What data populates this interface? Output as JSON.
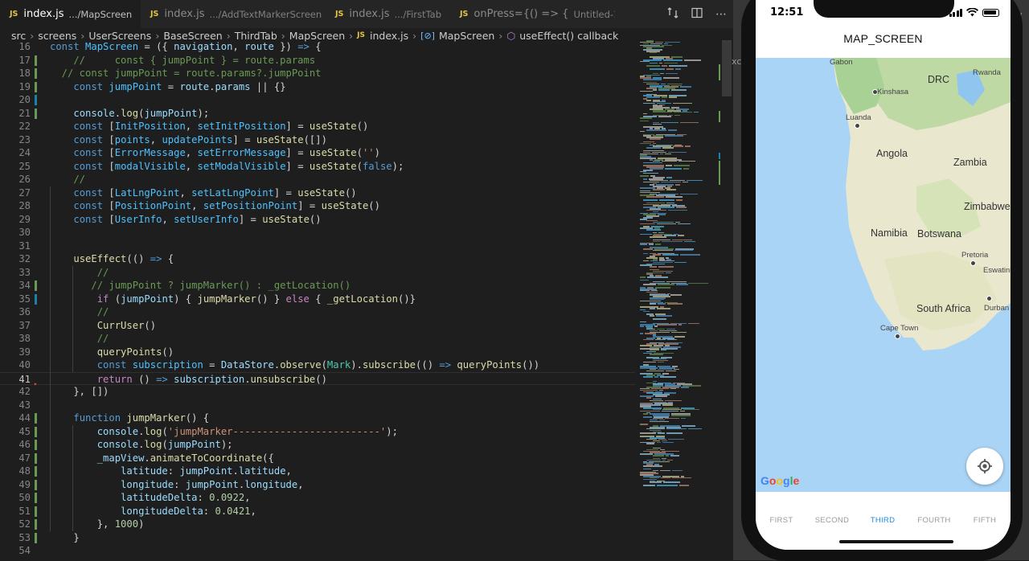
{
  "editor": {
    "tabs": [
      {
        "name": "index.js",
        "desc": ".../MapScreen",
        "active": true
      },
      {
        "name": "index.js",
        "desc": ".../AddTextMarkerScreen",
        "active": false
      },
      {
        "name": "index.js",
        "desc": ".../FirstTab",
        "active": false
      },
      {
        "name": "onPress={() => {",
        "desc": "Untitled-1",
        "active": false
      }
    ],
    "breadcrumb": [
      "src",
      "screens",
      "UserScreens",
      "BaseScreen",
      "ThirdTab",
      "MapScreen",
      "index.js",
      "MapScreen",
      "useEffect() callback"
    ],
    "lines": [
      {
        "n": "16",
        "t": [
          [
            "const ",
            "#569cd6"
          ],
          [
            "MapScreen",
            "#4fc1ff"
          ],
          [
            " = ({ ",
            "#d4d4d4"
          ],
          [
            "navigation",
            "#9cdcfe"
          ],
          [
            ", ",
            "#d4d4d4"
          ],
          [
            "route",
            "#9cdcfe"
          ],
          [
            " }) ",
            "#d4d4d4"
          ],
          [
            "=>",
            "#569cd6"
          ],
          [
            " {",
            "#d4d4d4"
          ]
        ]
      },
      {
        "n": "17",
        "t": [
          [
            "    //     const { jumpPoint } = route.params",
            "#6a9955"
          ]
        ]
      },
      {
        "n": "18",
        "t": [
          [
            "  // const jumpPoint = route.params?.jumpPoint",
            "#6a9955"
          ]
        ]
      },
      {
        "n": "19",
        "t": [
          [
            "    ",
            "#d4d4d4"
          ],
          [
            "const ",
            "#569cd6"
          ],
          [
            "jumpPoint",
            "#4fc1ff"
          ],
          [
            " = ",
            "#d4d4d4"
          ],
          [
            "route",
            "#9cdcfe"
          ],
          [
            ".",
            "#d4d4d4"
          ],
          [
            "params",
            "#9cdcfe"
          ],
          [
            " || {}",
            "#d4d4d4"
          ]
        ]
      },
      {
        "n": "20",
        "t": [
          [
            "",
            "#d4d4d4"
          ]
        ]
      },
      {
        "n": "21",
        "t": [
          [
            "    ",
            "#d4d4d4"
          ],
          [
            "console",
            "#9cdcfe"
          ],
          [
            ".",
            "#d4d4d4"
          ],
          [
            "log",
            "#dcdcaa"
          ],
          [
            "(",
            "#d4d4d4"
          ],
          [
            "jumpPoint",
            "#9cdcfe"
          ],
          [
            ");",
            "#d4d4d4"
          ]
        ]
      },
      {
        "n": "22",
        "t": [
          [
            "    ",
            "#d4d4d4"
          ],
          [
            "const ",
            "#569cd6"
          ],
          [
            "[",
            "#d4d4d4"
          ],
          [
            "InitPosition",
            "#4fc1ff"
          ],
          [
            ", ",
            "#d4d4d4"
          ],
          [
            "setInitPosition",
            "#4fc1ff"
          ],
          [
            "] = ",
            "#d4d4d4"
          ],
          [
            "useState",
            "#dcdcaa"
          ],
          [
            "()",
            "#d4d4d4"
          ]
        ]
      },
      {
        "n": "23",
        "t": [
          [
            "    ",
            "#d4d4d4"
          ],
          [
            "const ",
            "#569cd6"
          ],
          [
            "[",
            "#d4d4d4"
          ],
          [
            "points",
            "#4fc1ff"
          ],
          [
            ", ",
            "#d4d4d4"
          ],
          [
            "updatePoints",
            "#4fc1ff"
          ],
          [
            "] = ",
            "#d4d4d4"
          ],
          [
            "useState",
            "#dcdcaa"
          ],
          [
            "([])",
            "#d4d4d4"
          ]
        ]
      },
      {
        "n": "24",
        "t": [
          [
            "    ",
            "#d4d4d4"
          ],
          [
            "const ",
            "#569cd6"
          ],
          [
            "[",
            "#d4d4d4"
          ],
          [
            "ErrorMessage",
            "#4fc1ff"
          ],
          [
            ", ",
            "#d4d4d4"
          ],
          [
            "setErrorMessage",
            "#4fc1ff"
          ],
          [
            "] = ",
            "#d4d4d4"
          ],
          [
            "useState",
            "#dcdcaa"
          ],
          [
            "(",
            "#d4d4d4"
          ],
          [
            "''",
            "#ce9178"
          ],
          [
            ")",
            "#d4d4d4"
          ]
        ]
      },
      {
        "n": "25",
        "t": [
          [
            "    ",
            "#d4d4d4"
          ],
          [
            "const ",
            "#569cd6"
          ],
          [
            "[",
            "#d4d4d4"
          ],
          [
            "modalVisible",
            "#4fc1ff"
          ],
          [
            ", ",
            "#d4d4d4"
          ],
          [
            "setModalVisible",
            "#4fc1ff"
          ],
          [
            "] = ",
            "#d4d4d4"
          ],
          [
            "useState",
            "#dcdcaa"
          ],
          [
            "(",
            "#d4d4d4"
          ],
          [
            "false",
            "#569cd6"
          ],
          [
            ");",
            "#d4d4d4"
          ]
        ]
      },
      {
        "n": "26",
        "t": [
          [
            "    //",
            "#6a9955"
          ]
        ]
      },
      {
        "n": "27",
        "t": [
          [
            "    ",
            "#d4d4d4"
          ],
          [
            "const ",
            "#569cd6"
          ],
          [
            "[",
            "#d4d4d4"
          ],
          [
            "LatLngPoint",
            "#4fc1ff"
          ],
          [
            ", ",
            "#d4d4d4"
          ],
          [
            "setLatLngPoint",
            "#4fc1ff"
          ],
          [
            "] = ",
            "#d4d4d4"
          ],
          [
            "useState",
            "#dcdcaa"
          ],
          [
            "()",
            "#d4d4d4"
          ]
        ]
      },
      {
        "n": "28",
        "t": [
          [
            "    ",
            "#d4d4d4"
          ],
          [
            "const ",
            "#569cd6"
          ],
          [
            "[",
            "#d4d4d4"
          ],
          [
            "PositionPoint",
            "#4fc1ff"
          ],
          [
            ", ",
            "#d4d4d4"
          ],
          [
            "setPositionPoint",
            "#4fc1ff"
          ],
          [
            "] = ",
            "#d4d4d4"
          ],
          [
            "useState",
            "#dcdcaa"
          ],
          [
            "()",
            "#d4d4d4"
          ]
        ]
      },
      {
        "n": "29",
        "t": [
          [
            "    ",
            "#d4d4d4"
          ],
          [
            "const ",
            "#569cd6"
          ],
          [
            "[",
            "#d4d4d4"
          ],
          [
            "UserInfo",
            "#4fc1ff"
          ],
          [
            ", ",
            "#d4d4d4"
          ],
          [
            "setUserInfo",
            "#4fc1ff"
          ],
          [
            "] = ",
            "#d4d4d4"
          ],
          [
            "useState",
            "#dcdcaa"
          ],
          [
            "()",
            "#d4d4d4"
          ]
        ]
      },
      {
        "n": "30",
        "t": [
          [
            "",
            "#d4d4d4"
          ]
        ]
      },
      {
        "n": "31",
        "t": [
          [
            "",
            "#d4d4d4"
          ]
        ]
      },
      {
        "n": "32",
        "t": [
          [
            "    ",
            "#d4d4d4"
          ],
          [
            "useEffect",
            "#dcdcaa"
          ],
          [
            "(() ",
            "#d4d4d4"
          ],
          [
            "=>",
            "#569cd6"
          ],
          [
            " {",
            "#d4d4d4"
          ]
        ]
      },
      {
        "n": "33",
        "t": [
          [
            "        //",
            "#6a9955"
          ]
        ]
      },
      {
        "n": "34",
        "t": [
          [
            "       // jumpPoint ? jumpMarker() : _getLocation()",
            "#6a9955"
          ]
        ]
      },
      {
        "n": "35",
        "t": [
          [
            "        ",
            "#d4d4d4"
          ],
          [
            "if",
            "#c586c0"
          ],
          [
            " (",
            "#d4d4d4"
          ],
          [
            "jumpPoint",
            "#9cdcfe"
          ],
          [
            ") { ",
            "#d4d4d4"
          ],
          [
            "jumpMarker",
            "#dcdcaa"
          ],
          [
            "() } ",
            "#d4d4d4"
          ],
          [
            "else",
            "#c586c0"
          ],
          [
            " { ",
            "#d4d4d4"
          ],
          [
            "_getLocation",
            "#dcdcaa"
          ],
          [
            "()}",
            "#d4d4d4"
          ]
        ]
      },
      {
        "n": "36",
        "t": [
          [
            "        //",
            "#6a9955"
          ]
        ]
      },
      {
        "n": "37",
        "t": [
          [
            "        ",
            "#d4d4d4"
          ],
          [
            "CurrUser",
            "#dcdcaa"
          ],
          [
            "()",
            "#d4d4d4"
          ]
        ]
      },
      {
        "n": "38",
        "t": [
          [
            "        //",
            "#6a9955"
          ]
        ]
      },
      {
        "n": "39",
        "t": [
          [
            "        ",
            "#d4d4d4"
          ],
          [
            "queryPoints",
            "#dcdcaa"
          ],
          [
            "()",
            "#d4d4d4"
          ]
        ]
      },
      {
        "n": "40",
        "t": [
          [
            "        ",
            "#d4d4d4"
          ],
          [
            "const ",
            "#569cd6"
          ],
          [
            "subscription",
            "#4fc1ff"
          ],
          [
            " = ",
            "#d4d4d4"
          ],
          [
            "DataStore",
            "#9cdcfe"
          ],
          [
            ".",
            "#d4d4d4"
          ],
          [
            "observe",
            "#dcdcaa"
          ],
          [
            "(",
            "#d4d4d4"
          ],
          [
            "Mark",
            "#4ec9b0"
          ],
          [
            ").",
            "#d4d4d4"
          ],
          [
            "subscribe",
            "#dcdcaa"
          ],
          [
            "(() ",
            "#d4d4d4"
          ],
          [
            "=>",
            "#569cd6"
          ],
          [
            " ",
            "#d4d4d4"
          ],
          [
            "queryPoints",
            "#dcdcaa"
          ],
          [
            "())",
            "#d4d4d4"
          ]
        ]
      },
      {
        "n": "41",
        "t": [
          [
            "        ",
            "#d4d4d4"
          ],
          [
            "return",
            "#c586c0"
          ],
          [
            " () ",
            "#d4d4d4"
          ],
          [
            "=>",
            "#569cd6"
          ],
          [
            " ",
            "#d4d4d4"
          ],
          [
            "subscription",
            "#9cdcfe"
          ],
          [
            ".",
            "#d4d4d4"
          ],
          [
            "unsubscribe",
            "#dcdcaa"
          ],
          [
            "()",
            "#d4d4d4"
          ]
        ]
      },
      {
        "n": "42",
        "t": [
          [
            "    }, [])",
            "#d4d4d4"
          ]
        ]
      },
      {
        "n": "43",
        "t": [
          [
            "",
            "#d4d4d4"
          ]
        ]
      },
      {
        "n": "44",
        "t": [
          [
            "    ",
            "#d4d4d4"
          ],
          [
            "function",
            "#569cd6"
          ],
          [
            " ",
            "#d4d4d4"
          ],
          [
            "jumpMarker",
            "#dcdcaa"
          ],
          [
            "() {",
            "#d4d4d4"
          ]
        ]
      },
      {
        "n": "45",
        "t": [
          [
            "        ",
            "#d4d4d4"
          ],
          [
            "console",
            "#9cdcfe"
          ],
          [
            ".",
            "#d4d4d4"
          ],
          [
            "log",
            "#dcdcaa"
          ],
          [
            "(",
            "#d4d4d4"
          ],
          [
            "'jumpMarker-------------------------'",
            "#ce9178"
          ],
          [
            ");",
            "#d4d4d4"
          ]
        ]
      },
      {
        "n": "46",
        "t": [
          [
            "        ",
            "#d4d4d4"
          ],
          [
            "console",
            "#9cdcfe"
          ],
          [
            ".",
            "#d4d4d4"
          ],
          [
            "log",
            "#dcdcaa"
          ],
          [
            "(",
            "#d4d4d4"
          ],
          [
            "jumpPoint",
            "#9cdcfe"
          ],
          [
            ");",
            "#d4d4d4"
          ]
        ]
      },
      {
        "n": "47",
        "t": [
          [
            "        ",
            "#d4d4d4"
          ],
          [
            "_mapView",
            "#9cdcfe"
          ],
          [
            ".",
            "#d4d4d4"
          ],
          [
            "animateToCoordinate",
            "#dcdcaa"
          ],
          [
            "({",
            "#d4d4d4"
          ]
        ]
      },
      {
        "n": "48",
        "t": [
          [
            "            ",
            "#d4d4d4"
          ],
          [
            "latitude",
            "#9cdcfe"
          ],
          [
            ": ",
            "#d4d4d4"
          ],
          [
            "jumpPoint",
            "#9cdcfe"
          ],
          [
            ".",
            "#d4d4d4"
          ],
          [
            "latitude",
            "#9cdcfe"
          ],
          [
            ",",
            "#d4d4d4"
          ]
        ]
      },
      {
        "n": "49",
        "t": [
          [
            "            ",
            "#d4d4d4"
          ],
          [
            "longitude",
            "#9cdcfe"
          ],
          [
            ": ",
            "#d4d4d4"
          ],
          [
            "jumpPoint",
            "#9cdcfe"
          ],
          [
            ".",
            "#d4d4d4"
          ],
          [
            "longitude",
            "#9cdcfe"
          ],
          [
            ",",
            "#d4d4d4"
          ]
        ]
      },
      {
        "n": "50",
        "t": [
          [
            "            ",
            "#d4d4d4"
          ],
          [
            "latitudeDelta",
            "#9cdcfe"
          ],
          [
            ": ",
            "#d4d4d4"
          ],
          [
            "0.0922",
            "#b5cea8"
          ],
          [
            ",",
            "#d4d4d4"
          ]
        ]
      },
      {
        "n": "51",
        "t": [
          [
            "            ",
            "#d4d4d4"
          ],
          [
            "longitudeDelta",
            "#9cdcfe"
          ],
          [
            ": ",
            "#d4d4d4"
          ],
          [
            "0.0421",
            "#b5cea8"
          ],
          [
            ",",
            "#d4d4d4"
          ]
        ]
      },
      {
        "n": "52",
        "t": [
          [
            "        }, ",
            "#d4d4d4"
          ],
          [
            "1000",
            "#b5cea8"
          ],
          [
            ")",
            "#d4d4d4"
          ]
        ]
      },
      {
        "n": "53",
        "t": [
          [
            "    }",
            "#d4d4d4"
          ]
        ]
      },
      {
        "n": "54",
        "t": [
          [
            "",
            "#d4d4d4"
          ]
        ]
      }
    ],
    "current_line": "41",
    "modified_gutter": {
      "17": "#6a9955",
      "18": "#6a9955",
      "19": "#6a9955",
      "20": "#1b81a8",
      "21": "#6a9955",
      "34": "#6a9955",
      "35": "#1b81a8",
      "44": "#6a9955",
      "45": "#6a9955",
      "46": "#6a9955",
      "47": "#6a9955",
      "48": "#6a9955",
      "49": "#6a9955",
      "50": "#6a9955",
      "51": "#6a9955",
      "52": "#6a9955",
      "53": "#6a9955"
    }
  },
  "phone": {
    "time": "12:51",
    "title": "MAP_SCREEN",
    "map_labels": {
      "gabon": "Gabon",
      "rwanda": "Rwanda",
      "drc": "DRC",
      "kinshasa": "Kinshasa",
      "luanda": "Luanda",
      "angola": "Angola",
      "zambia": "Zambia",
      "zimbabwe": "Zimbabwe",
      "namibia": "Namibia",
      "botswana": "Botswana",
      "pretoria": "Pretoria",
      "eswatini": "Eswatini",
      "south_africa": "South Africa",
      "durban": "Durban",
      "cape_town": "Cape Town"
    },
    "google": "Google",
    "tabs": [
      "FIRST",
      "SECOND",
      "THIRD",
      "FOURTH",
      "FIFTH"
    ],
    "active_tab": "THIRD"
  },
  "side_text": {
    "top": "y",
    "mid": "xc"
  }
}
